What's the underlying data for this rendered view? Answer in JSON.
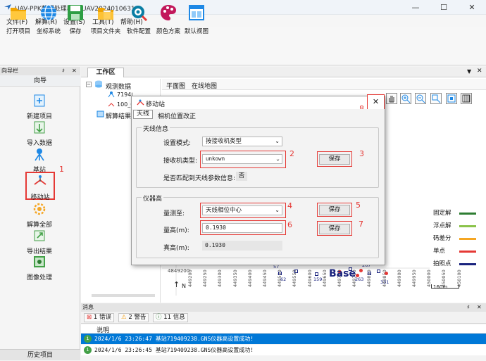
{
  "app": {
    "title": "UAV-PPK数据处理软件-UAV2024010631"
  },
  "window_controls": {
    "minimize": "—",
    "maximize": "☐",
    "close": "✕"
  },
  "menu": [
    "文件(F)",
    "解算(R)",
    "设置(S)",
    "工具(T)",
    "帮助(H)"
  ],
  "toolbar": [
    {
      "label": "打开项目",
      "icon": "folder-open-icon"
    },
    {
      "label": "坐标系统",
      "icon": "globe-icon"
    },
    {
      "label": "保存",
      "icon": "save-icon"
    },
    {
      "label": "项目文件夹",
      "icon": "project-folder-icon"
    },
    {
      "label": "软件配置",
      "icon": "settings-magnifier-icon"
    },
    {
      "label": "颜色方案",
      "icon": "palette-icon"
    },
    {
      "label": "默认视图",
      "icon": "default-view-icon"
    }
  ],
  "nav": {
    "panel_title": "向导栏",
    "pin": "♯",
    "close": "✕",
    "header": "向导",
    "items": [
      {
        "label": "新建项目",
        "icon": "new-project-icon"
      },
      {
        "label": "导入数据",
        "icon": "import-data-icon"
      },
      {
        "label": "基站",
        "icon": "base-station-icon"
      },
      {
        "label": "移动站",
        "icon": "rover-station-icon"
      },
      {
        "label": "解算全部",
        "icon": "solve-all-icon"
      },
      {
        "label": "导出结果",
        "icon": "export-results-icon"
      },
      {
        "label": "图像处理",
        "icon": "image-processing-icon"
      }
    ],
    "history": "历史项目",
    "annotation": "1"
  },
  "workspace": {
    "tab": "工作区",
    "tree": {
      "root": "观测数据",
      "children": [
        "719409238_GNS",
        "100_0"
      ],
      "results": "解算结果"
    },
    "map_tabs": [
      "平面图",
      "在线地图"
    ],
    "map_tools": [
      "hand-icon",
      "zoom-in-icon",
      "zoom-out-icon",
      "zoom-window-icon",
      "zoom-extent-icon",
      "grid-icon"
    ],
    "legend": [
      {
        "label": "固定解",
        "color": "#2e7d32"
      },
      {
        "label": "浮点解",
        "color": "#8bc34a"
      },
      {
        "label": "码差分",
        "color": "#f5a623"
      },
      {
        "label": "单点",
        "color": "#e53935"
      },
      {
        "label": "拍照点",
        "color": "#1a237e"
      }
    ],
    "y_tick": "4849200",
    "x_ticks": [
      "449200",
      "449250",
      "449300",
      "449350",
      "449400",
      "449450",
      "449500",
      "449550",
      "449600",
      "449650",
      "449700",
      "449750",
      "449800",
      "449850",
      "449900",
      "449950",
      "450000",
      "450050",
      "450100"
    ],
    "point_labels": [
      "57",
      "62",
      "159",
      "263",
      "267",
      "331"
    ],
    "base_label": "Base",
    "scale": "160m",
    "north": "N"
  },
  "dialog": {
    "title": "移动站",
    "tabs": [
      "天线",
      "相机位置改正"
    ],
    "antenna_group": "天线信息",
    "mode_label": "设置模式:",
    "mode_value": "按接收机类型",
    "receiver_label": "接收机类型:",
    "receiver_value": "unkown",
    "match_label": "是否匹配到天线参数信息:",
    "match_value": "否",
    "height_group": "仪器高",
    "method_label": "量测至:",
    "method_value": "天线相位中心",
    "measured_label": "量高(m):",
    "measured_value": "0.1930",
    "true_label": "真高(m):",
    "true_value": "0.1930",
    "save_label": "保存",
    "annotations": [
      "2",
      "3",
      "4",
      "5",
      "6",
      "7",
      "8"
    ]
  },
  "messages": {
    "panel_title": "消息",
    "tabs": [
      "1 错误",
      "2 警告",
      "11 信息"
    ],
    "column": "说明",
    "rows": [
      {
        "text": "2024/1/6 23:26:47  基站719409238.GNS仪器高设置成功!",
        "selected": true
      },
      {
        "text": "2024/1/6 23:26:45  基站719409238.GNS仪器高设置成功!",
        "selected": false
      }
    ]
  }
}
